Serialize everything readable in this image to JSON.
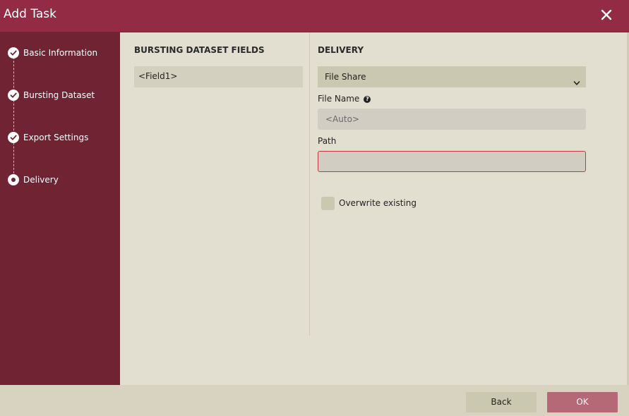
{
  "dialog": {
    "title": "Add Task"
  },
  "sidebar": {
    "steps": [
      {
        "label": "Basic Information",
        "state": "completed"
      },
      {
        "label": "Bursting Dataset",
        "state": "completed"
      },
      {
        "label": "Export Settings",
        "state": "completed"
      },
      {
        "label": "Delivery",
        "state": "current"
      }
    ]
  },
  "fields_panel": {
    "title": "BURSTING DATASET FIELDS",
    "items": [
      "<Field1>"
    ]
  },
  "delivery": {
    "title": "DELIVERY",
    "method": "File Share",
    "file_name_label": "File Name",
    "file_name_placeholder": "<Auto>",
    "path_label": "Path",
    "path_value": "",
    "overwrite_label": "Overwrite existing",
    "overwrite_checked": false
  },
  "footer": {
    "back_label": "Back",
    "ok_label": "OK"
  },
  "colors": {
    "titlebar": "#942b44",
    "sidebar": "#702433",
    "content": "#e2dfd0",
    "ok_button": "#b56977",
    "invalid_border": "#c9343e"
  }
}
